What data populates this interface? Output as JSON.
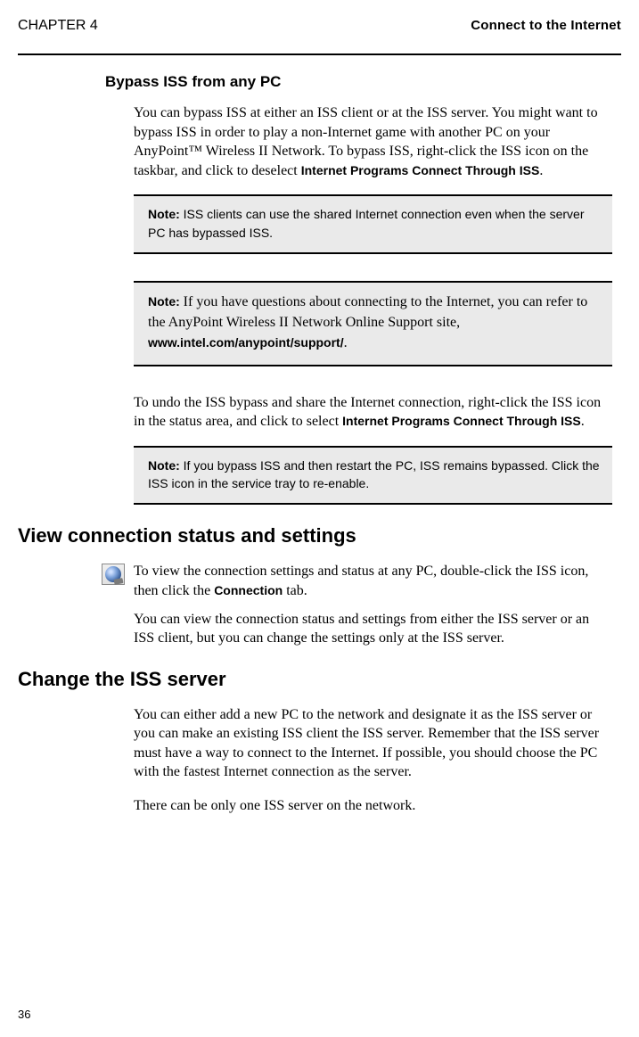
{
  "header": {
    "chapter": "CHAPTER 4",
    "title": "Connect to the Internet"
  },
  "sections": {
    "bypass": {
      "heading": "Bypass ISS from any PC",
      "p1_a": "You can bypass ISS at either an ISS client or at the ISS server. You might want to bypass ISS in order to play a non-Internet game with another PC on your AnyPoint™ Wireless II Network. To bypass ISS, right-click the ISS icon on the taskbar, and click to deselect ",
      "p1_bold": "Internet Programs Connect Through ISS",
      "p1_b": ".",
      "note1": {
        "label": "Note:  ",
        "text": "ISS clients can use the shared Internet connection even when the server PC has bypassed ISS."
      },
      "note2": {
        "label": "Note:  ",
        "text_a": "If you have questions about connecting to the Internet, you can refer to the AnyPoint Wireless II Network Online Support site, ",
        "bold": "www.intel.com/anypoint/support/",
        "text_b": "."
      },
      "p2_a": "To undo the ISS bypass and share the Internet connection, right-click the ISS icon in the status area, and click to select ",
      "p2_bold": "Internet Programs Connect Through ISS",
      "p2_b": ".",
      "note3": {
        "label": "Note:  ",
        "text": "If you bypass ISS and then restart the PC, ISS remains bypassed. Click the ISS icon in the service tray to re-enable."
      }
    },
    "view": {
      "heading": "View connection status and settings",
      "p1_a": "To view the connection settings and status at any PC, double-click the ISS icon, then click the ",
      "p1_bold": "Connection",
      "p1_b": " tab.",
      "p2": "You can view the connection status and settings from either the ISS server or an ISS client, but you can change the settings only at the ISS server."
    },
    "change": {
      "heading": "Change the ISS server",
      "p1": "You can either add a new PC to the network and designate it as the ISS server or you can make an existing ISS client the ISS server. Remember that the ISS server must have a way to connect to the Internet. If possible, you should choose the PC with the fastest Internet connection as the server.",
      "p2": "There can be only one ISS server on the network."
    }
  },
  "pageNumber": "36"
}
